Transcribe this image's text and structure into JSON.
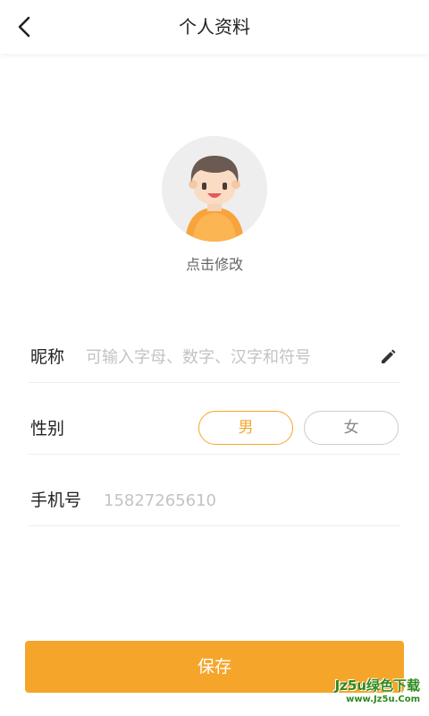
{
  "header": {
    "title": "个人资料",
    "back_icon": "chevron-left-icon"
  },
  "avatar": {
    "caption": "点击修改"
  },
  "form": {
    "nickname": {
      "label": "昵称",
      "placeholder": "可输入字母、数字、汉字和符号",
      "value": "",
      "edit_icon": "pencil-icon"
    },
    "gender": {
      "label": "性别",
      "options": [
        "男",
        "女"
      ],
      "selected": "男"
    },
    "phone": {
      "label": "手机号",
      "placeholder": "15827265610",
      "value": ""
    }
  },
  "save_button": {
    "label": "保存"
  },
  "watermark": {
    "main": "Jz5u绿色下载",
    "sub": "www.Jz5u.Com"
  },
  "colors": {
    "accent": "#f5a62a",
    "text_primary": "#222222",
    "placeholder": "#c3c3c3",
    "divider": "#ededed"
  }
}
